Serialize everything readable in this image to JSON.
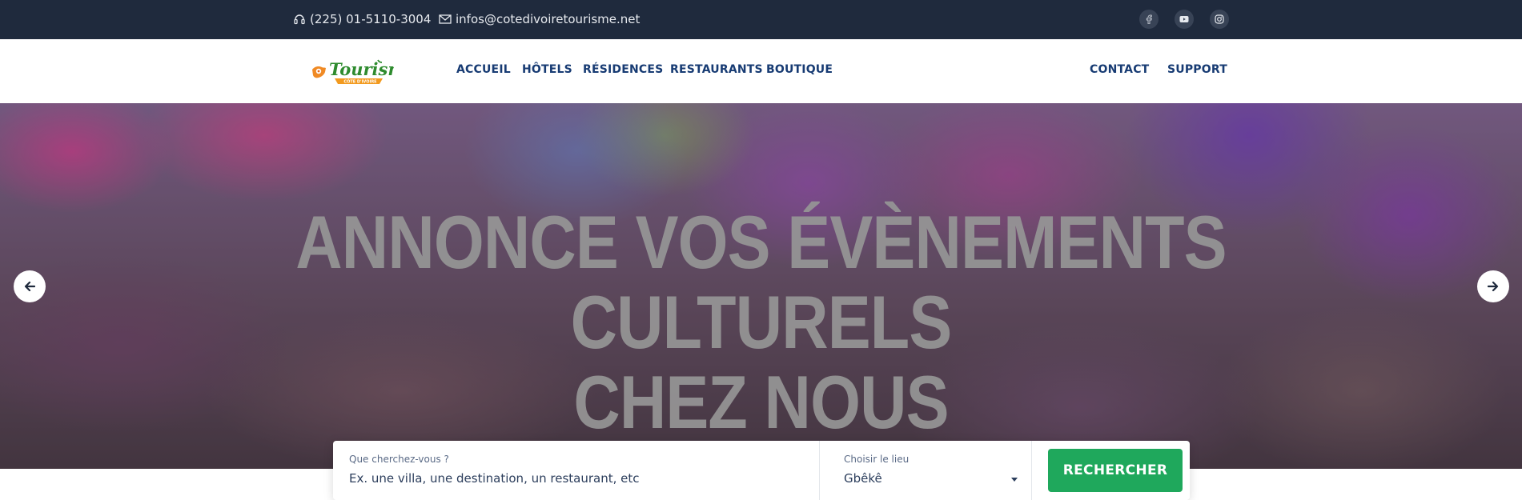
{
  "topbar": {
    "phone": "(225) 01-5110-3004",
    "email": "infos@cotedivoiretourisme.net",
    "social": [
      "facebook-icon",
      "youtube-icon",
      "instagram-icon"
    ]
  },
  "logo": {
    "word": "Tourisme",
    "sub": "CÔTE D'IVOIRE"
  },
  "nav": {
    "left": [
      "ACCUEIL",
      "HÔTELS",
      "RÉSIDENCES",
      "RESTAURANTS",
      "BOUTIQUE"
    ],
    "right": [
      "CONTACT",
      "SUPPORT"
    ]
  },
  "hero": {
    "line1": "ANNONCE VOS ÉVÈNEMENTS CULTURELS",
    "line2": "CHEZ NOUS"
  },
  "search": {
    "what_label": "Que cherchez-vous ?",
    "what_placeholder": "Ex. une villa, une destination, un restaurant, etc",
    "place_label": "Choisir le lieu",
    "place_value": "Gbêkê",
    "button": "RECHERCHER"
  },
  "colors": {
    "topbar": "#1f2a3d",
    "nav_text": "#173b73",
    "button": "#1fa85c"
  }
}
